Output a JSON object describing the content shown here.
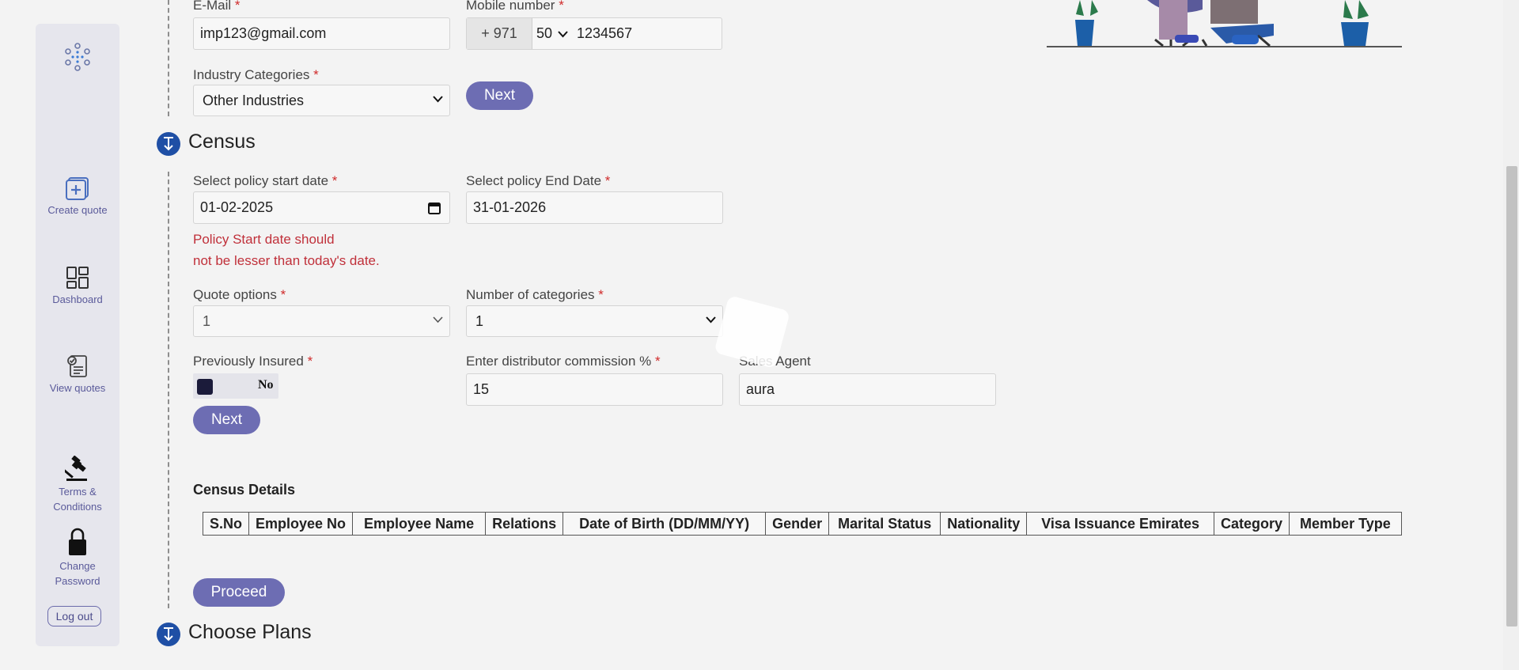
{
  "sidebar": {
    "items": [
      {
        "label": "Create quote"
      },
      {
        "label": "Dashboard"
      },
      {
        "label": "View quotes"
      },
      {
        "label_line1": "Terms &",
        "label_line2": "Conditions"
      },
      {
        "label_line1": "Change",
        "label_line2": "Password"
      }
    ],
    "logout_label": "Log out"
  },
  "contact": {
    "email_label": "E-Mail",
    "email_value": "imp123@gmail.com",
    "mobile_label": "Mobile number",
    "mobile_code": "+ 971",
    "mobile_prefix": "50",
    "mobile_number": "1234567",
    "industry_label": "Industry Categories",
    "industry_value": "Other Industries",
    "next_label": "Next"
  },
  "census": {
    "title": "Census",
    "start_date_label": "Select policy start date",
    "start_date_value": "01-02-2025",
    "end_date_label": "Select policy End Date",
    "end_date_value": "31-01-2026",
    "error_line1": "Policy Start date should",
    "error_line2": "not be lesser than today's date.",
    "quote_options_label": "Quote options",
    "quote_options_value": "1",
    "num_categories_label": "Number of categories",
    "num_categories_value": "1",
    "previously_insured_label": "Previously Insured",
    "previously_insured_value": "No",
    "commission_label": "Enter distributor commission %",
    "commission_value": "15",
    "sales_agent_label": "Sales Agent",
    "sales_agent_value": "aura",
    "next_label": "Next",
    "details_title": "Census Details",
    "table_headers": [
      "S.No",
      "Employee No",
      "Employee Name",
      "Relations",
      "Date of Birth (DD/MM/YY)",
      "Gender",
      "Marital Status",
      "Nationality",
      "Visa Issuance Emirates",
      "Category",
      "Member Type"
    ],
    "proceed_label": "Proceed"
  },
  "choose_plans": {
    "title": "Choose Plans"
  },
  "required_mark": "*",
  "colors": {
    "accent": "#6d6db3",
    "step_icon": "#1f4fa5",
    "error": "#c0303a",
    "sidebar_bg": "#e6e6ed"
  }
}
